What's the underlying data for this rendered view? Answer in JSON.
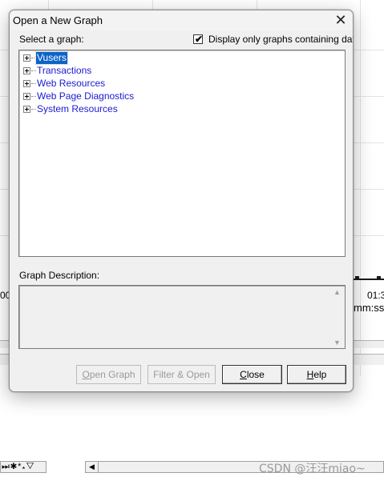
{
  "dialog": {
    "title": "Open a New Graph",
    "select_label": "Select a graph:",
    "checkbox_label": "Display only graphs containing data",
    "checkbox_checked": true,
    "checkbox_mark": "✔",
    "close_glyph": "✕",
    "tree_items": [
      {
        "label": "Vusers",
        "selected": true
      },
      {
        "label": "Transactions",
        "selected": false
      },
      {
        "label": "Web Resources",
        "selected": false
      },
      {
        "label": "Web Page Diagnostics",
        "selected": false
      },
      {
        "label": "System Resources",
        "selected": false
      }
    ],
    "description_label": "Graph Description:",
    "buttons": {
      "open_graph": {
        "accel": "O",
        "rest": "pen Graph",
        "enabled": false
      },
      "filter_open": {
        "label": "Filter & Open",
        "enabled": false
      },
      "close": {
        "accel": "C",
        "rest": "lose",
        "enabled": true
      },
      "help": {
        "accel": "H",
        "rest": "elp",
        "enabled": true
      }
    },
    "scroll_up_glyph": "▲",
    "scroll_down_glyph": "▼"
  },
  "background": {
    "axis_left_label": "00",
    "axis_right_label": "01:3",
    "axis_unit": "mm:ss",
    "toolbar_glyphs": "⏭✱*⁎▽",
    "scroll_left_glyph": "◀",
    "watermark": "CSDN @汪汪miao~"
  },
  "colors": {
    "selection": "#0a64c8",
    "link_text": "#1a1ad0",
    "dialog_bg": "#f0f0f0"
  }
}
